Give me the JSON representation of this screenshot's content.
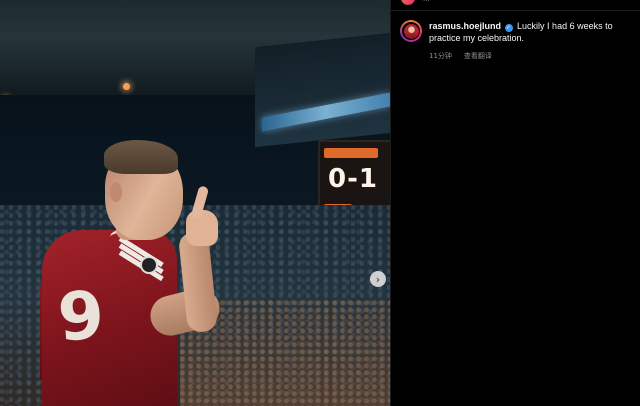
{
  "photo": {
    "scoreboard_text": "0-1",
    "shirt_number": "9",
    "next_icon": "›"
  },
  "side_panel": {
    "top_text": "...",
    "comment": {
      "username": "rasmus.hoejlund",
      "verified_icon": "✓",
      "text": "Luckily I had 6 weeks to practice my celebration.",
      "time": "11分钟",
      "translate_label": "查看翻译"
    }
  },
  "colors": {
    "background": "#000000",
    "verified_badge": "#3897f0",
    "shirt_red": "#a3222a",
    "muted_text": "#8e8e8e"
  }
}
